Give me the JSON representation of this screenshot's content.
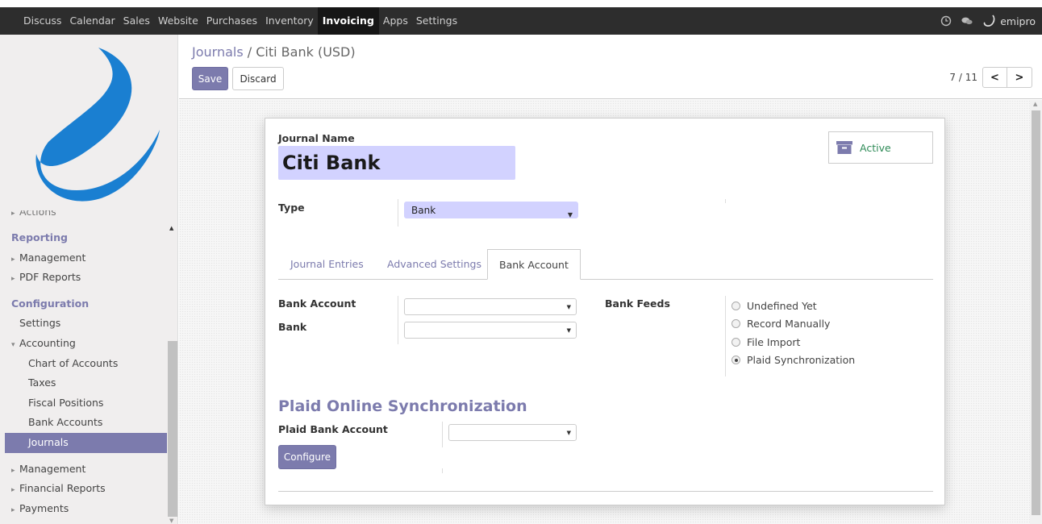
{
  "topbar": {
    "menu": [
      "Discuss",
      "Calendar",
      "Sales",
      "Website",
      "Purchases",
      "Inventory",
      "Invoicing",
      "Apps",
      "Settings"
    ],
    "active_menu": "Invoicing",
    "user": "emipro",
    "icons": [
      "clock-icon",
      "chat-icon",
      "user-logo-icon"
    ]
  },
  "sidebar": {
    "partial_item": "Actions",
    "reporting_header": "Reporting",
    "reporting_items": [
      "Management",
      "PDF Reports"
    ],
    "configuration_header": "Configuration",
    "settings": "Settings",
    "accounting": "Accounting",
    "accounting_items": [
      "Chart of Accounts",
      "Taxes",
      "Fiscal Positions",
      "Bank Accounts"
    ],
    "selected": "Journals",
    "bottom_items": [
      "Management",
      "Financial Reports",
      "Payments"
    ]
  },
  "breadcrumb": {
    "parent": "Journals",
    "separator": "/",
    "current": "Citi Bank (USD)"
  },
  "buttons": {
    "save": "Save",
    "discard": "Discard",
    "configure": "Configure"
  },
  "pager": {
    "value": "7 / 11",
    "prev": "<",
    "next": ">"
  },
  "form": {
    "journal_name_label": "Journal Name",
    "journal_name": "Citi Bank",
    "active_label": "Active",
    "type_label": "Type",
    "type_value": "Bank",
    "tabs": [
      "Journal Entries",
      "Advanced Settings",
      "Bank Account"
    ],
    "active_tab": "Bank Account",
    "bank_account_label": "Bank Account",
    "bank_label": "Bank",
    "bank_feeds_label": "Bank Feeds",
    "bank_feeds_options": [
      "Undefined Yet",
      "Record Manually",
      "File Import",
      "Plaid Synchronization"
    ],
    "bank_feeds_selected": "Plaid Synchronization",
    "plaid_section_title": "Plaid Online Synchronization",
    "plaid_bank_account_label": "Plaid Bank Account"
  },
  "colors": {
    "brand": "#7c7bad",
    "topbar": "#2d2d2d",
    "name_field": "#d2d2ff",
    "active": "#2e8b57"
  }
}
